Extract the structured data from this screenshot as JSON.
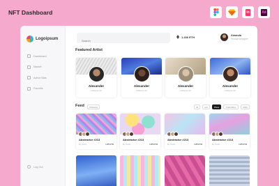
{
  "promo": {
    "title": "NFT Dashboard",
    "tools": [
      {
        "icon": "figma-icon",
        "label": ""
      },
      {
        "icon": "sketch-icon",
        "label": ""
      },
      {
        "icon": "indesign-icon",
        "label": "In"
      },
      {
        "icon": "xd-icon",
        "label": "Xd"
      }
    ]
  },
  "sidebar": {
    "logo_text": "Logoipsum",
    "items": [
      {
        "label": "Dashboard",
        "icon": "dashboard-icon"
      },
      {
        "label": "Market",
        "icon": "market-icon"
      },
      {
        "label": "Active Bids",
        "icon": "bids-icon"
      },
      {
        "label": "Favorite",
        "icon": "favorite-icon"
      }
    ],
    "logout_label": "Log Out"
  },
  "header": {
    "search_placeholder": "Search",
    "wallet_balance": "1.436 ETH",
    "user_name": "Amanda",
    "user_role": "Product Designer"
  },
  "featured": {
    "title": "Featured Artist",
    "artists": [
      {
        "name": "Alexander",
        "subtitle": "Collector Art"
      },
      {
        "name": "Alexander",
        "subtitle": "Collector Art"
      },
      {
        "name": "Alexander",
        "subtitle": "Collector Art"
      },
      {
        "name": "Alexander",
        "subtitle": "Collector Art"
      }
    ]
  },
  "feed": {
    "title": "Feed",
    "following_label": "Following",
    "filters": [
      "All",
      "Arts",
      "Photo",
      "Collectibles",
      "Utility"
    ],
    "active_filter": "Photo",
    "items": [
      {
        "title": "Abstractor #213",
        "owner": "By Justin",
        "price": "1.85 ETH"
      },
      {
        "title": "Abstractor #213",
        "owner": "By Justin",
        "price": "1.85 ETH"
      },
      {
        "title": "Abstractor #213",
        "owner": "By Justin",
        "price": "1.85 ETH"
      },
      {
        "title": "Abstractor #213",
        "owner": "By Justin",
        "price": "1.85 ETH"
      }
    ]
  },
  "colors": {
    "background": "#f4a9cd",
    "active_chip": "#1c1c1c"
  }
}
